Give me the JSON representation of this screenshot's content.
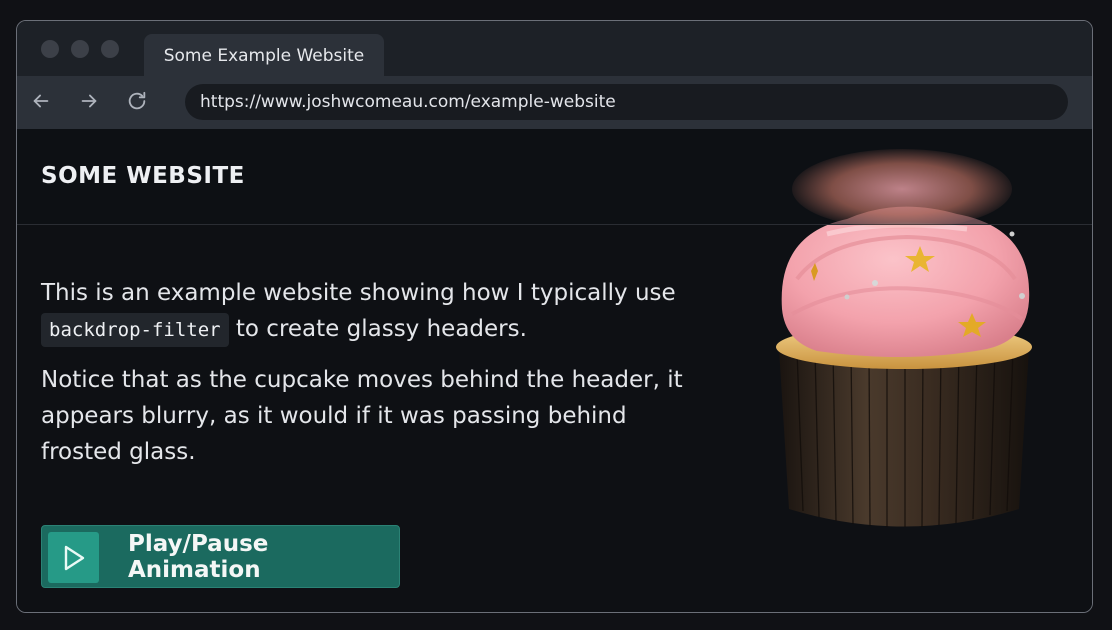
{
  "browser": {
    "tab_title": "Some Example Website",
    "url": "https://www.joshwcomeau.com/example-website"
  },
  "site": {
    "title": "SOME WEBSITE",
    "paragraph1_before": "This is an example website showing how I typically use",
    "paragraph1_code": "backdrop-filter",
    "paragraph1_after": "to create glassy headers.",
    "paragraph2": "Notice that as the cupcake moves behind the header, it appears blurry, as it would if it was passing behind frosted glass.",
    "button_label": "Play/Pause Animation"
  },
  "colors": {
    "accent": "#1b6a5f",
    "accent_light": "#269a87",
    "frosting": "#f4a3ad"
  },
  "icons": {
    "back": "arrow-left-icon",
    "forward": "arrow-right-icon",
    "reload": "reload-icon",
    "play": "play-icon"
  }
}
